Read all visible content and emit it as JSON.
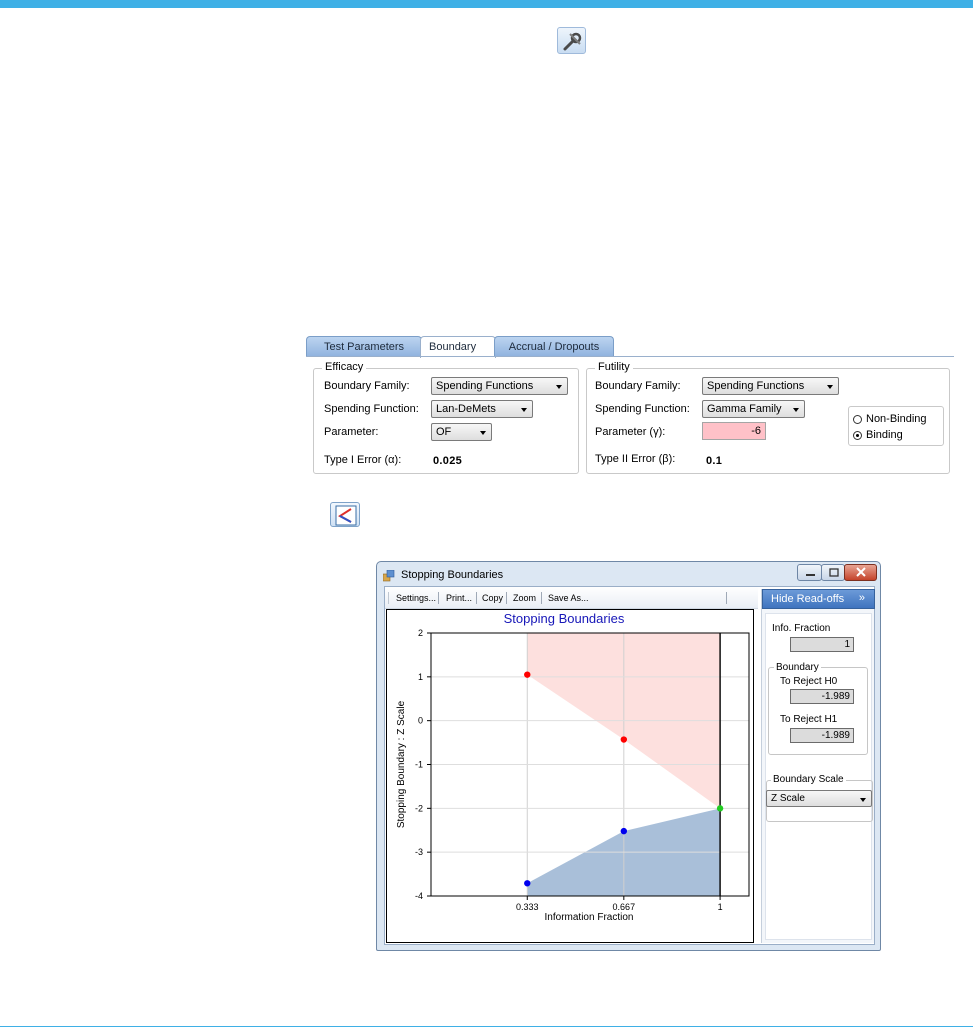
{
  "tabs": [
    {
      "label": "Test Parameters"
    },
    {
      "label": "Boundary"
    },
    {
      "label": "Accrual / Dropouts"
    }
  ],
  "efficacy": {
    "title": "Efficacy",
    "family_label": "Boundary Family:",
    "family_value": "Spending Functions",
    "spending_label": "Spending Function:",
    "spending_value": "Lan-DeMets",
    "parameter_label": "Parameter:",
    "parameter_value": "OF",
    "error_label": "Type I Error (α):",
    "error_value": "0.025"
  },
  "futility": {
    "title": "Futility",
    "family_label": "Boundary Family:",
    "family_value": "Spending Functions",
    "spending_label": "Spending Function:",
    "spending_value": "Gamma Family",
    "parameter_label": "Parameter (γ):",
    "parameter_value": "-6",
    "error_label": "Type II Error (β):",
    "error_value": "0.1",
    "radio_nonbinding": "Non-Binding",
    "radio_binding": "Binding"
  },
  "icons": {
    "tool": "wrench-icon",
    "chart": "chart-icon"
  },
  "window": {
    "title": "Stopping Boundaries",
    "toolbar": [
      "Settings...",
      "Print...",
      "Copy",
      "Zoom",
      "Save As..."
    ],
    "hide_label": "Hide Read-offs",
    "hide_chevron": "»"
  },
  "readoffs": {
    "info_label": "Info. Fraction",
    "info_value": "1",
    "boundary_title": "Boundary",
    "reject_h0_label": "To Reject H0",
    "reject_h0_value": "-1.989",
    "reject_h1_label": "To Reject H1",
    "reject_h1_value": "-1.989",
    "scale_title": "Boundary Scale",
    "scale_value": "Z Scale"
  },
  "chart_data": {
    "type": "line",
    "title": "Stopping Boundaries",
    "xlabel": "Information Fraction",
    "ylabel": "Stopping Boundary : Z Scale",
    "x_ticks": [
      "0.333",
      "0.667",
      "1"
    ],
    "y_ticks": [
      "2",
      "1",
      "0",
      "-1",
      "-2",
      "-3",
      "-4"
    ],
    "xlim": [
      0,
      1.1
    ],
    "ylim": [
      -4,
      2
    ],
    "series": [
      {
        "key": "efficacy",
        "color": "#ff0000",
        "fill": "#fde0de",
        "x": [
          0.333,
          0.667,
          1
        ],
        "y": [
          1.05,
          -0.43,
          -2.0
        ]
      },
      {
        "key": "futility",
        "color": "#0000ee",
        "fill": "#a9bfd9",
        "x": [
          0.333,
          0.667,
          1
        ],
        "y": [
          -3.71,
          -2.52,
          -2.0
        ]
      }
    ],
    "final_point": {
      "x": 1,
      "y": -2.0,
      "color": "#22cc22"
    }
  }
}
